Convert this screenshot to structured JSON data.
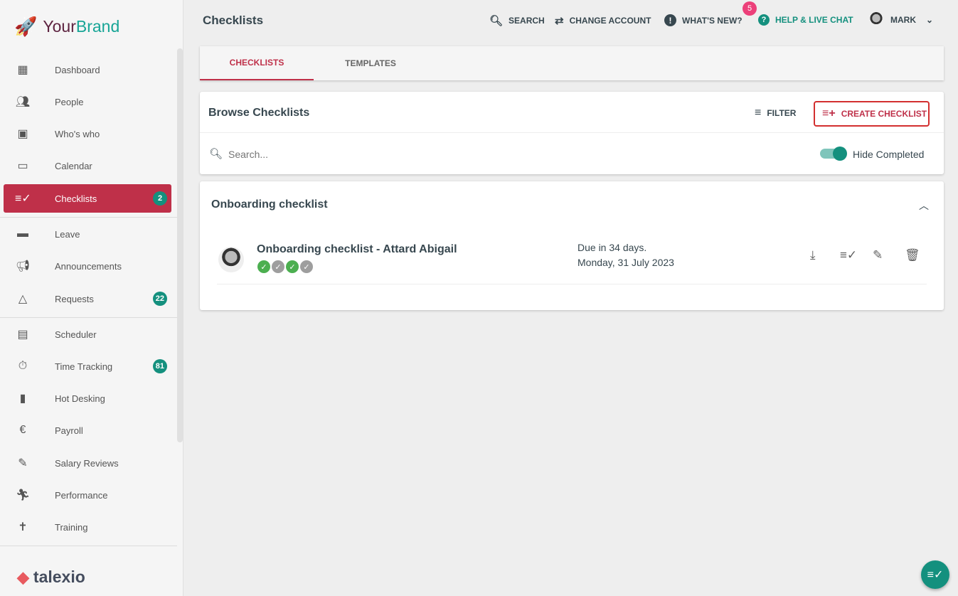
{
  "brand": {
    "part1": "Your",
    "part2": "Brand",
    "footer": "talexio"
  },
  "sidebar": {
    "items": [
      {
        "label": "Dashboard",
        "icon": "dashboard-icon"
      },
      {
        "label": "People",
        "icon": "people-icon"
      },
      {
        "label": "Who's who",
        "icon": "contact-card-icon"
      },
      {
        "label": "Calendar",
        "icon": "calendar-icon"
      },
      {
        "label": "Checklists",
        "icon": "checklist-icon",
        "badge": "2",
        "active": true
      },
      {
        "label": "Leave",
        "icon": "leave-icon"
      },
      {
        "label": "Announcements",
        "icon": "announcement-icon"
      },
      {
        "label": "Requests",
        "icon": "triangle-icon",
        "badge": "22"
      },
      {
        "label": "Scheduler",
        "icon": "event-icon"
      },
      {
        "label": "Time Tracking",
        "icon": "timer-icon",
        "badge": "81"
      },
      {
        "label": "Hot Desking",
        "icon": "door-icon"
      },
      {
        "label": "Payroll",
        "icon": "euro-icon"
      },
      {
        "label": "Salary Reviews",
        "icon": "rate-review-icon"
      },
      {
        "label": "Performance",
        "icon": "run-icon"
      },
      {
        "label": "Training",
        "icon": "accessibility-icon"
      }
    ]
  },
  "header": {
    "title": "Checklists",
    "search": "SEARCH",
    "change_account": "CHANGE ACCOUNT",
    "whats_new": "WHAT'S NEW?",
    "whats_new_count": "5",
    "help": "HELP & LIVE CHAT",
    "user": "MARK"
  },
  "tabs": [
    {
      "label": "CHECKLISTS",
      "active": true
    },
    {
      "label": "TEMPLATES"
    }
  ],
  "browse": {
    "title": "Browse Checklists",
    "filter": "FILTER",
    "create": "CREATE CHECKLIST",
    "search_placeholder": "Search...",
    "hide_completed": "Hide Completed",
    "hide_completed_on": true
  },
  "group": {
    "title": "Onboarding checklist",
    "items": [
      {
        "name": "Onboarding checklist - Attard Abigail",
        "due": "Due in 34 days.",
        "date": "Monday, 31 July 2023",
        "steps": [
          "done",
          "pending",
          "done",
          "pending"
        ]
      }
    ]
  },
  "colors": {
    "primary": "#bf3049",
    "accent": "#14907e",
    "done": "#4caf50",
    "pending": "#9e9e9e"
  }
}
